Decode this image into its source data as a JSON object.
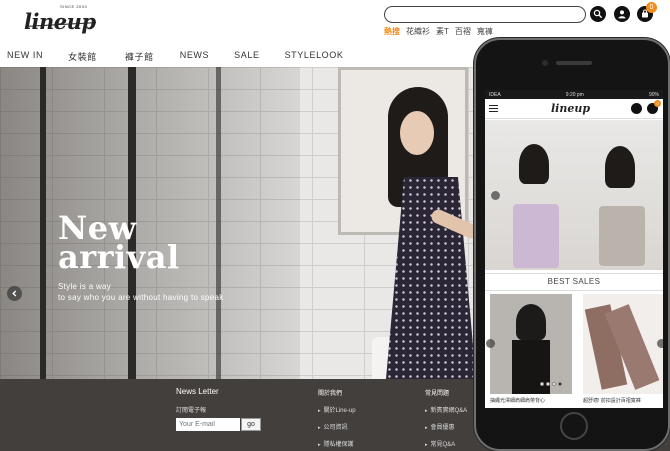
{
  "header": {
    "logo_since": "SINCE 2003",
    "logo_text": "lineup",
    "search_placeholder": "",
    "hot_label": "熱搜",
    "hot_terms": [
      "花織衫",
      "素T",
      "百褶",
      "寬褲"
    ],
    "cart_count": "0"
  },
  "nav": {
    "items": [
      "NEW IN",
      "女裝館",
      "褲子館",
      "NEWS",
      "SALE",
      "STYLELOOK"
    ]
  },
  "hero": {
    "title_line1": "New",
    "title_line2": "arrival",
    "sub_line1": "Style is a way",
    "sub_line2": "to say who you are without having to speak"
  },
  "footer": {
    "newsletter_title": "News Letter",
    "newsletter_sub": "訂閱電子報",
    "email_placeholder": "Your E-mail",
    "go_label": "go",
    "about_title": "關於我們",
    "about_links": [
      "關於Line-up",
      "公司資訊",
      "隱私權保護"
    ],
    "faq_title": "常見問題",
    "faq_links": [
      "新賓實網Q&A",
      "會員優惠",
      "常見Q&A"
    ]
  },
  "mobile": {
    "carrier": "IDEA",
    "time": "9:20 pm",
    "battery": "90%",
    "logo_text": "lineup",
    "cart_count": "0",
    "best_sales_title": "BEST SALES",
    "product1_caption": "抽繩光澤細肩細肩帶背心",
    "product2_caption": "超舒適! 前扣設計百褶寬褲"
  },
  "colors": {
    "accent": "#f28c1c",
    "footer_bg": "#433f3c",
    "icon_dark": "#111111"
  }
}
